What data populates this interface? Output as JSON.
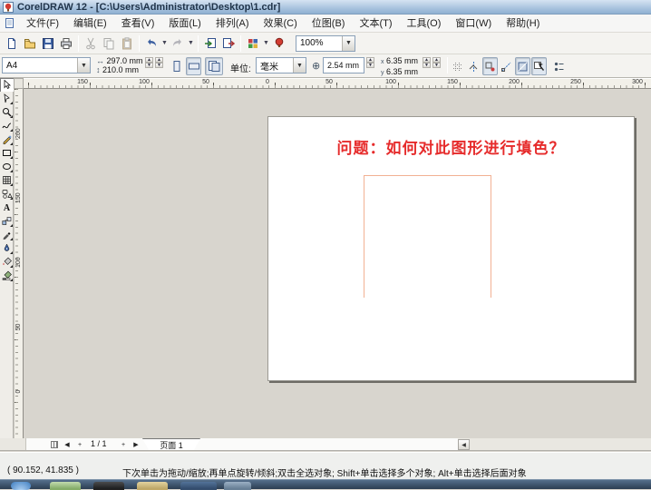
{
  "window": {
    "title": "CorelDRAW 12 - [C:\\Users\\Administrator\\Desktop\\1.cdr]"
  },
  "menu": {
    "items": [
      {
        "label": "文件(F)"
      },
      {
        "label": "编辑(E)"
      },
      {
        "label": "查看(V)"
      },
      {
        "label": "版面(L)"
      },
      {
        "label": "排列(A)"
      },
      {
        "label": "效果(C)"
      },
      {
        "label": "位图(B)"
      },
      {
        "label": "文本(T)"
      },
      {
        "label": "工具(O)"
      },
      {
        "label": "窗口(W)"
      },
      {
        "label": "帮助(H)"
      }
    ]
  },
  "standard_toolbar": {
    "zoom_level": "100%",
    "dropdown_arrow": "▼"
  },
  "property_bar": {
    "paper_type": "A4",
    "paper_width": "297.0 mm",
    "paper_height": "210.0 mm",
    "width_icon": "↔",
    "height_icon": "↕",
    "units_label": "单位:",
    "units_value": "毫米",
    "nudge_icon": "⊕",
    "nudge_offset": "2.54 mm",
    "duplicate_x_label": "x",
    "duplicate_y_label": "y",
    "duplicate_x": "6.35 mm",
    "duplicate_y": "6.35 mm"
  },
  "rulers": {
    "horizontal": [
      "150",
      "100",
      "50",
      "0",
      "50",
      "100",
      "150",
      "200",
      "250",
      "300"
    ],
    "vertical": [
      "200",
      "150",
      "100",
      "50",
      "0"
    ]
  },
  "canvas": {
    "heading": "问题：如何对此图形进行填色？",
    "heading_color": "#e62b2b",
    "shape_stroke": "#f2b193"
  },
  "page_nav": {
    "first": "◀",
    "prev": "+",
    "indicator": "1 / 1",
    "next": "+",
    "last": "▶",
    "tab": "页面 1",
    "scroll_left": "◀"
  },
  "status_bar": {
    "coordinates": "( 90.152, 41.835 )",
    "hint": "下次单击为拖动/缩放;再单点旋转/倾斜;双击全选对象; Shift+单击选择多个对象; Alt+单击选择后面对象"
  },
  "colors": {
    "titlebar_top": "#d5e3f2",
    "titlebar_bottom": "#8fb0d2",
    "canvas_bg": "#d8d5ce"
  }
}
